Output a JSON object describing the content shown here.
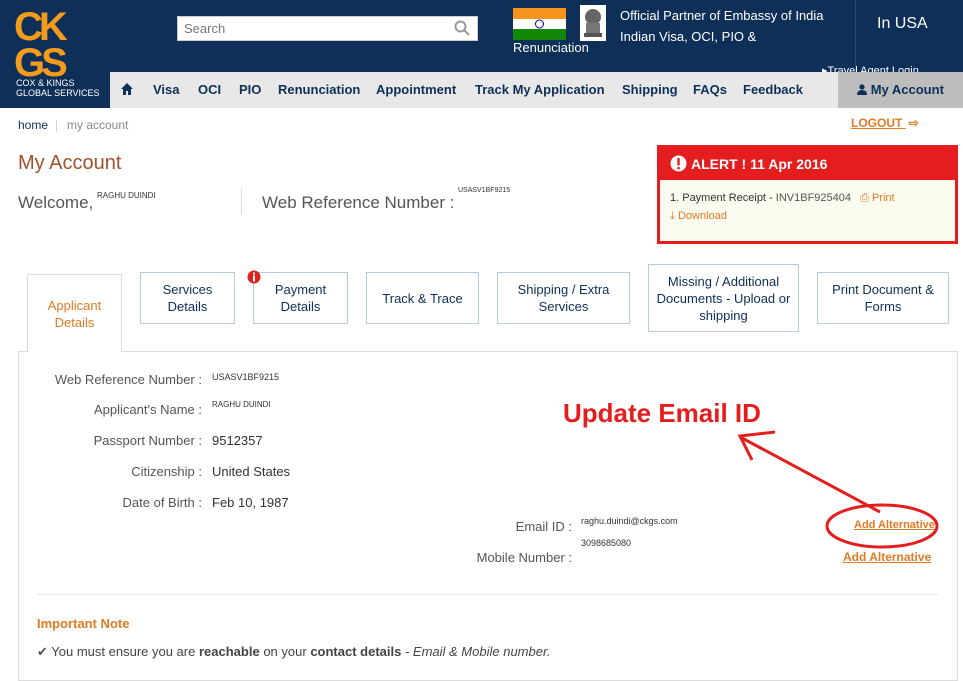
{
  "logo": {
    "letters": "CKGS",
    "sub": "COX & KINGS GLOBAL SERVICES"
  },
  "search": {
    "placeholder": "Search"
  },
  "header": {
    "renunciation": "Renunciation",
    "partner": "Official Partner of Embassy of India Indian Visa, OCI, PIO &",
    "country": "In USA",
    "travel_agent": "Travel Agent Login"
  },
  "nav": {
    "items": [
      "Visa",
      "OCI",
      "PIO",
      "Renunciation",
      "Appointment",
      "Track My Application",
      "Shipping",
      "FAQs",
      "Feedback"
    ],
    "my_account": "My Account"
  },
  "breadcrumb": {
    "home": "home",
    "current": "my account",
    "sep": "|"
  },
  "logout": "LOGOUT",
  "page": {
    "title": "My Account",
    "welcome_label": "Welcome,",
    "welcome_name": "RAGHU DUINDI",
    "web_ref_label": "Web Reference Number :",
    "web_ref_value": "USASV1BF9215"
  },
  "alert": {
    "title": "ALERT ! 11 Apr 2016",
    "item": "1. Payment Receipt -",
    "invoice": "INV1BF925404",
    "print": "Print",
    "download": "Download"
  },
  "tabs": [
    {
      "label": "Applicant Details"
    },
    {
      "label": "Services Details"
    },
    {
      "label": "Payment Details"
    },
    {
      "label": "Track & Trace"
    },
    {
      "label": "Shipping / Extra Services"
    },
    {
      "label": "Missing / Additional Documents - Upload or shipping"
    },
    {
      "label": "Print Document & Forms"
    }
  ],
  "details": {
    "web_ref": {
      "label": "Web Reference Number :",
      "value": "USASV1BF9215"
    },
    "name": {
      "label": "Applicant's Name :",
      "value": "RAGHU DUINDI"
    },
    "passport": {
      "label": "Passport Number :",
      "value": "9512357"
    },
    "citizenship": {
      "label": "Citizenship :",
      "value": "United States"
    },
    "dob": {
      "label": "Date of Birth :",
      "value": "Feb 10, 1987"
    },
    "email": {
      "label": "Email ID :",
      "value": "raghu.duindi@ckgs.com"
    },
    "mobile": {
      "label": "Mobile Number :",
      "value": "3098685080"
    },
    "add_alternative": "Add Alternative"
  },
  "annotation": "Update Email ID",
  "note": {
    "title": "Important Note",
    "prefix": "You must ensure you are",
    "b1": "reachable",
    "mid": "on your",
    "b2": "contact details",
    "suffix": "- Email & Mobile number."
  },
  "colors": {
    "brand_navy": "#0e2f58",
    "accent_orange": "#e07a25",
    "alert_red": "#e41e1e"
  }
}
